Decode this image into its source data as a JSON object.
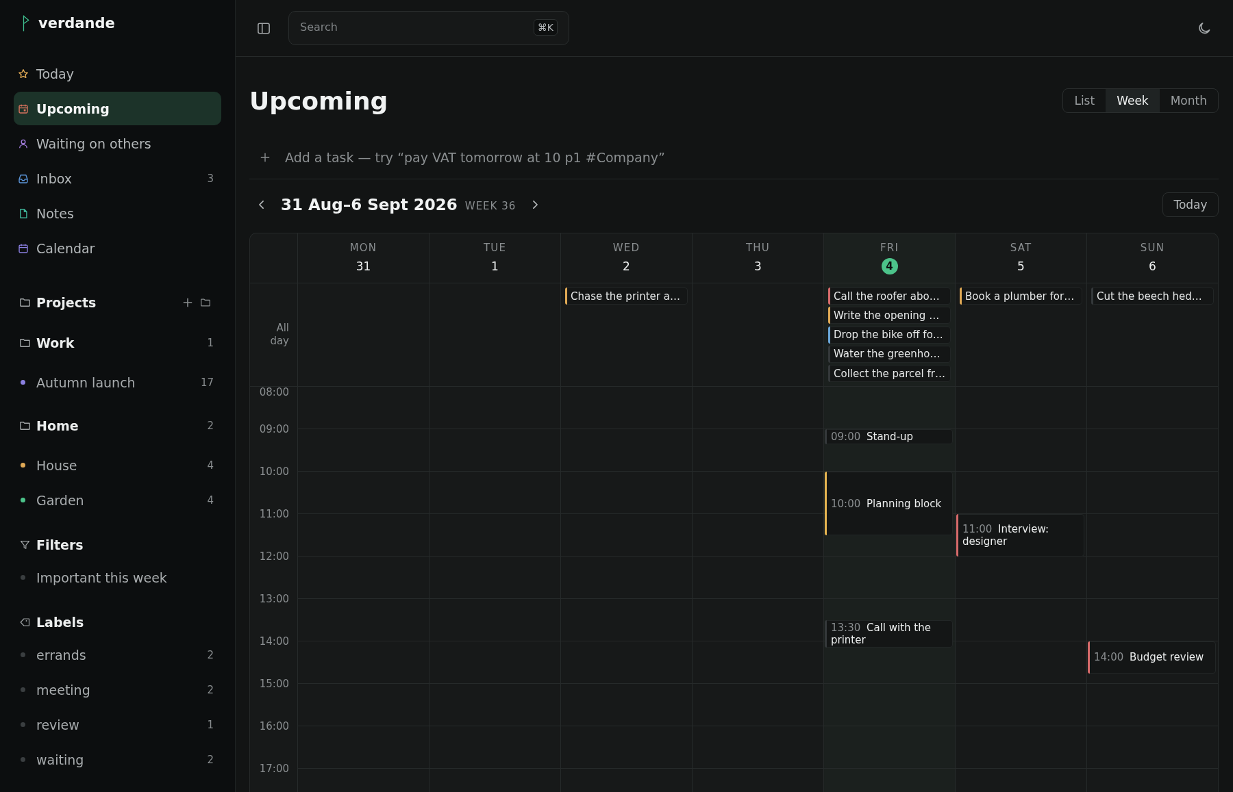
{
  "sidebar": {
    "brand": "verdande",
    "nav": [
      {
        "kind": "today",
        "label": "Today",
        "selected": false
      },
      {
        "kind": "upcoming",
        "label": "Upcoming",
        "selected": true
      },
      {
        "kind": "waiting",
        "label": "Waiting on others",
        "selected": false
      },
      {
        "kind": "inbox",
        "label": "Inbox",
        "count": "3",
        "selected": false
      },
      {
        "kind": "notes",
        "label": "Notes",
        "selected": false
      },
      {
        "kind": "calendar",
        "label": "Calendar",
        "selected": false
      }
    ],
    "projects": {
      "title": "Projects",
      "groups": [
        {
          "name": "Work",
          "count": "1",
          "children": [
            {
              "name": "Autumn launch",
              "count": "17",
              "color": "#8b80e0"
            }
          ]
        },
        {
          "name": "Home",
          "count": "2",
          "children": [
            {
              "name": "House",
              "count": "4",
              "color": "#e0a955"
            },
            {
              "name": "Garden",
              "count": "4",
              "color": "#4cc38a"
            }
          ]
        }
      ]
    },
    "filters": {
      "title": "Filters",
      "items": [
        {
          "name": "Important this week"
        }
      ]
    },
    "labels": {
      "title": "Labels",
      "items": [
        {
          "name": "errands",
          "count": "2"
        },
        {
          "name": "meeting",
          "count": "2"
        },
        {
          "name": "review",
          "count": "1"
        },
        {
          "name": "waiting",
          "count": "2"
        }
      ]
    }
  },
  "topbar": {
    "search": {
      "placeholder": "Search",
      "shortcut": "⌘K"
    }
  },
  "page": {
    "title": "Upcoming",
    "views": [
      {
        "label": "List",
        "selected": false
      },
      {
        "label": "Week",
        "selected": true
      },
      {
        "label": "Month",
        "selected": false
      }
    ],
    "add_task": {
      "placeholder": "Add a task — try “pay VAT tomorrow at 10 p1 #Company”"
    },
    "week_nav": {
      "range": "31 Aug–6 Sept 2026",
      "week": "WEEK 36",
      "today_button": "Today"
    }
  },
  "calendar": {
    "all_day_label": "All day",
    "hours": [
      "08:00",
      "09:00",
      "10:00",
      "11:00",
      "12:00",
      "13:00",
      "14:00",
      "15:00",
      "16:00",
      "17:00"
    ],
    "days": [
      {
        "name": "MON",
        "date": "31",
        "today": false
      },
      {
        "name": "TUE",
        "date": "1",
        "today": false
      },
      {
        "name": "WED",
        "date": "2",
        "today": false,
        "all_day": [
          {
            "title": "Chase the printer a…",
            "color": "#e0a955"
          }
        ]
      },
      {
        "name": "THU",
        "date": "3",
        "today": false
      },
      {
        "name": "FRI",
        "date": "4",
        "today": true,
        "all_day": [
          {
            "title": "Call the roofer abo…",
            "color": "#d66a6a"
          },
          {
            "title": "Write the opening …",
            "color": "#e0a955"
          },
          {
            "title": "Drop the bike off fo…",
            "color": "#6aa6d8"
          },
          {
            "title": "Water the greenho…",
            "color": "#34383a"
          },
          {
            "title": "Collect the parcel fr…",
            "color": "#34383a"
          }
        ],
        "events": [
          {
            "kind": "quarter",
            "time": "09:00",
            "title": "Stand-up",
            "color": "#34383a"
          },
          {
            "kind": "ninety",
            "time": "10:00",
            "title": "Planning block",
            "color": "#e6b450"
          },
          {
            "kind": "half",
            "time": "13:30",
            "title": "Call with the printer",
            "color": "#34383a"
          }
        ]
      },
      {
        "name": "SAT",
        "date": "5",
        "today": false,
        "all_day": [
          {
            "title": "Book a plumber for…",
            "color": "#e0a955"
          }
        ],
        "events": [
          {
            "kind": "hour",
            "time": "11:00",
            "title": "Interview: designer",
            "color": "#d66a6a"
          }
        ]
      },
      {
        "name": "SUN",
        "date": "6",
        "today": false,
        "all_day": [
          {
            "title": "Cut the beech hed…",
            "color": "#34383a"
          }
        ],
        "events": [
          {
            "kind": "threequarters",
            "time": "14:00",
            "title": "Budget review",
            "color": "#d66a6a"
          }
        ]
      }
    ]
  }
}
